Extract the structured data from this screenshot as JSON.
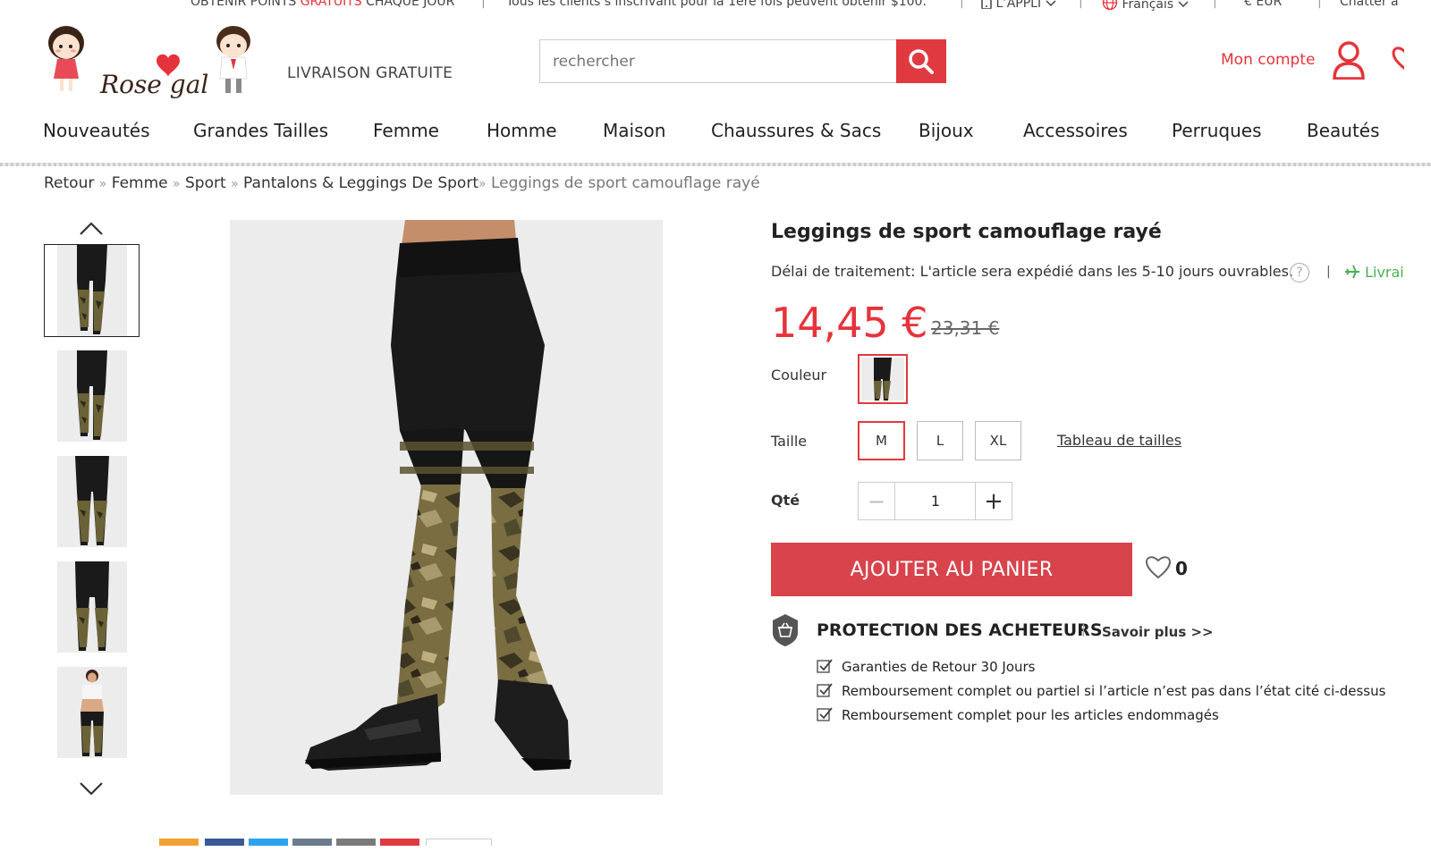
{
  "topbar": {
    "points_prefix": "OBTENIR POINTS ",
    "points_red": "GRATUITS",
    "points_suffix": " CHAQUE JOUR",
    "promo": "Tous les clients s’inscrivant pour la 1ère fois peuvent obtenir $100.",
    "app": "L’APPLI",
    "language": "Français",
    "currency": "€ EUR",
    "chat": "Chatter a"
  },
  "header": {
    "logo_text": "Rose gal",
    "free_shipping": "LIVRAISON GRATUITE",
    "search_placeholder": "rechercher",
    "account": "Mon compte"
  },
  "nav": [
    "Nouveautés",
    "Grandes Tailles",
    "Femme",
    "Homme",
    "Maison",
    "Chaussures & Sacs",
    "Bijoux",
    "Accessoires",
    "Perruques",
    "Beautés"
  ],
  "breadcrumb": {
    "items": [
      "Retour",
      "Femme",
      "Sport",
      "Pantalons & Leggings De Sport"
    ],
    "separator": "»",
    "current": "Leggings de sport camouflage rayé"
  },
  "product": {
    "title": "Leggings de sport camouflage rayé",
    "processing": "Délai de traitement: L'article sera expédié dans les 5-10 jours ouvrables.",
    "help": "?",
    "pipe": "|",
    "shipping_partial": "Livrai",
    "price": "14,45 €",
    "old_price": "23,31 €",
    "color_label": "Couleur",
    "size_label": "Taille",
    "sizes": [
      "M",
      "L",
      "XL"
    ],
    "selected_size": "M",
    "size_chart": "Tableau de tailles",
    "qty_label": "Qté",
    "qty_value": "1",
    "qty_minus": "−",
    "qty_plus": "+",
    "add_to_cart": "AJOUTER AU PANIER",
    "wishlist_count": "0"
  },
  "protection": {
    "title": "PROTECTION DES ACHETEURS",
    "sep": "|",
    "more": "Savoir plus >>",
    "items": [
      "Garanties de Retour 30 Jours",
      "Remboursement complet ou partiel si l’article n’est pas dans l’état cité ci-dessus",
      "Remboursement complet pour les articles endommagés"
    ]
  },
  "colors": {
    "accent": "#e0393f",
    "price": "#e6333b",
    "cart_button": "#d8434c",
    "shipping_green": "#4caf50"
  }
}
